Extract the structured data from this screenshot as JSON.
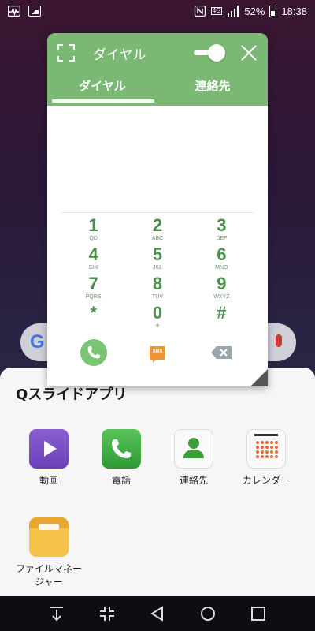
{
  "status_bar": {
    "battery": "52%",
    "time": "18:38",
    "network": "4G",
    "icons": [
      "activity-icon",
      "image-icon",
      "nfc-icon",
      "signal-icon",
      "battery-icon"
    ]
  },
  "dialer": {
    "window_title": "ダイヤル",
    "tabs": [
      "ダイヤル",
      "連絡先"
    ],
    "keys": [
      {
        "digit": "1",
        "letters": "QD"
      },
      {
        "digit": "2",
        "letters": "ABC"
      },
      {
        "digit": "3",
        "letters": "DEF"
      },
      {
        "digit": "4",
        "letters": "GHI"
      },
      {
        "digit": "5",
        "letters": "JKL"
      },
      {
        "digit": "6",
        "letters": "MNO"
      },
      {
        "digit": "7",
        "letters": "PQRS"
      },
      {
        "digit": "8",
        "letters": "TUV"
      },
      {
        "digit": "9",
        "letters": "WXYZ"
      },
      {
        "digit": "*",
        "letters": ""
      },
      {
        "digit": "0",
        "letters": "+"
      },
      {
        "digit": "#",
        "letters": ""
      }
    ],
    "sms_label": "SMS",
    "accent_color": "#7bb874"
  },
  "qslide": {
    "title": "Qスライドアプリ",
    "apps": [
      {
        "label": "動画",
        "icon": "video-icon"
      },
      {
        "label": "電話",
        "icon": "phone-icon"
      },
      {
        "label": "連絡先",
        "icon": "contacts-icon"
      },
      {
        "label": "カレンダー",
        "icon": "calendar-icon"
      },
      {
        "label": "ファイルマネージャー",
        "icon": "folder-icon"
      }
    ]
  }
}
